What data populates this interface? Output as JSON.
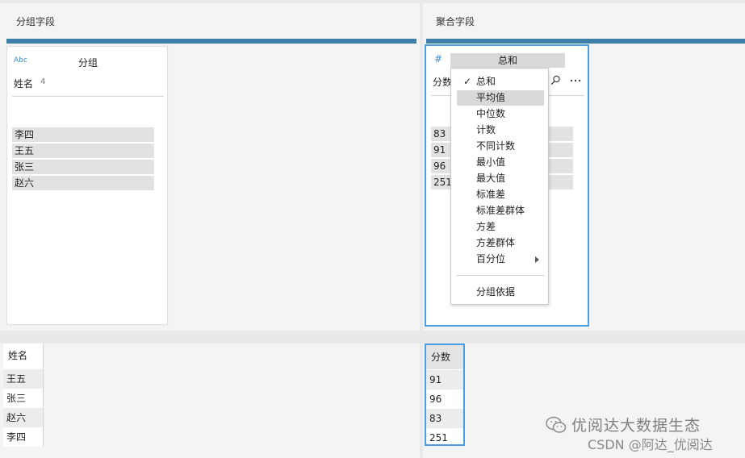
{
  "left_pane": {
    "header": "分组字段",
    "card": {
      "type_label": "Abc",
      "title": "分组",
      "field_name": "姓名",
      "count": "4",
      "values": [
        "李四",
        "王五",
        "张三",
        "赵六"
      ]
    }
  },
  "right_pane": {
    "header": "聚合字段",
    "card": {
      "type_label": "#",
      "title": "总和",
      "field_name_partial": "分数",
      "values_partial": [
        "83",
        "91",
        "96",
        "251"
      ]
    },
    "icons": [
      "search-icon",
      "more-icon"
    ]
  },
  "aggregation_menu": {
    "items": [
      {
        "label": "总和",
        "checked": true
      },
      {
        "label": "平均值",
        "highlighted": true
      },
      {
        "label": "中位数"
      },
      {
        "label": "计数"
      },
      {
        "label": "不同计数"
      },
      {
        "label": "最小值"
      },
      {
        "label": "最大值"
      },
      {
        "label": "标准差"
      },
      {
        "label": "标准差群体"
      },
      {
        "label": "方差"
      },
      {
        "label": "方差群体"
      },
      {
        "label": "百分位",
        "submenu": true
      }
    ],
    "footer_item": "分组依据",
    "check_glyph": "✓"
  },
  "bottom_left": {
    "header": "姓名",
    "rows": [
      "王五",
      "张三",
      "赵六",
      "李四"
    ]
  },
  "bottom_right": {
    "header": "分数",
    "rows": [
      "91",
      "96",
      "83",
      "251"
    ]
  },
  "watermark": {
    "line1": "优阅达大数据生态",
    "line2": "CSDN @阿达_优阅达"
  },
  "colors": {
    "accent_bar": "#3d7ea6",
    "selection_border": "#4a9de0"
  }
}
